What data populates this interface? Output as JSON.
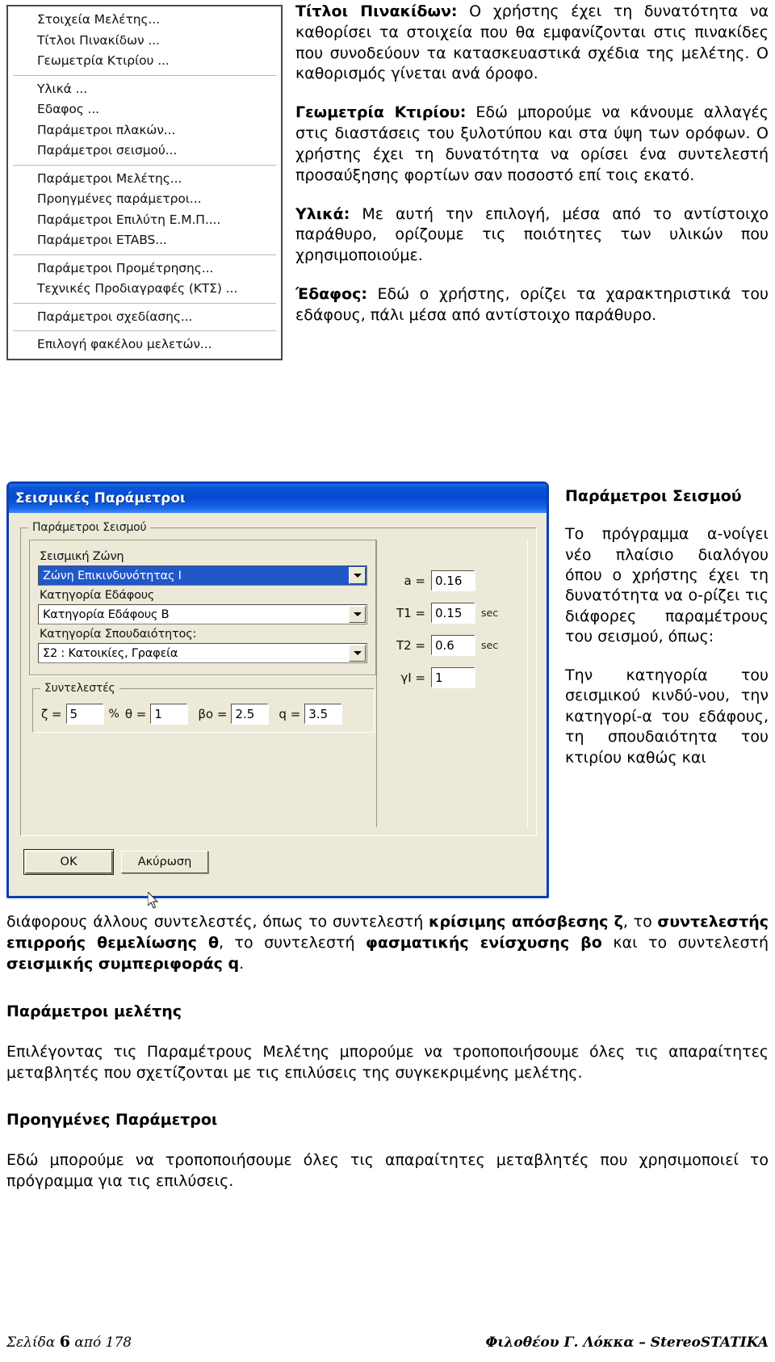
{
  "menu": {
    "groups": [
      {
        "items": [
          "Στοιχεία Μελέτης...",
          "Τίτλοι Πινακίδων ...",
          "Γεωμετρία Κτιρίου ..."
        ]
      },
      {
        "items": [
          "Υλικά ...",
          "Εδαφος ...",
          "Παράμετροι πλακών...",
          "Παράμετροι σεισμού..."
        ]
      },
      {
        "items": [
          "Παράμετροι Μελέτης...",
          "Προηγμένες παράμετροι...",
          "Παράμετροι Επιλύτη Ε.Μ.Π....",
          "Παράμετροι ETABS..."
        ]
      },
      {
        "items": [
          "Παράμετροι Προμέτρησης...",
          "Τεχνικές Προδιαγραφές (ΚΤΣ) ..."
        ]
      },
      {
        "items": [
          "Παράμετροι σχεδίασης..."
        ]
      },
      {
        "items": [
          "Επιλογή φακέλου μελετών..."
        ]
      }
    ]
  },
  "top_text": {
    "p1_lead": "Τίτλοι Πινακίδων:",
    "p1_body": " Ο χρήστης έχει τη δυνατότητα να καθορίσει τα στοιχεία που θα εμφανίζονται στις πινακίδες που συνοδεύουν τα κατασκευαστικά σχέδια της μελέτης. Ο καθορισμός γίνεται ανά όροφο.",
    "p2_lead": "Γεωμετρία Κτιρίου:",
    "p2_body": " Εδώ μπορούμε να κάνουμε αλλαγές στις διαστάσεις του ξυλοτύπου και στα ύψη των ορόφων. Ο χρήστης έχει τη δυνατότητα να ορίσει ένα συντελεστή προσαύξησης φορτίων σαν ποσοστό επί τοις εκατό.",
    "p3_lead": "Υλικά:",
    "p3_body": " Με αυτή την επιλογή, μέσα από το αντίστοιχο παράθυρο, ορίζουμε τις ποιότητες των υλικών που χρησιμοποιούμε.",
    "p4_lead": "Έδαφος:",
    "p4_body": " Εδώ ο χρήστης, ορίζει τα χαρακτηριστικά του εδάφους, πάλι μέσα από αντίστοιχο παράθυρο."
  },
  "dialog": {
    "title": "Σεισμικές Παράμετροι",
    "group_legend": "Παράμετροι Σεισμού",
    "fields": {
      "zone_label": "Σεισμική Ζώνη",
      "zone_value": "Ζώνη Επικινδυνότητας Ι",
      "soil_label": "Κατηγορία Εδάφους",
      "soil_value": "Κατηγορία Εδάφους Β",
      "importance_label": "Κατηγορία Σπουδαιότητος:",
      "importance_value": "Σ2 : Κατοικίες, Γραφεία"
    },
    "coefficients": {
      "legend": "Συντελεστές",
      "zeta_label": "ζ =",
      "zeta_value": "5",
      "zeta_unit": "%",
      "theta_label": "θ =",
      "theta_value": "1",
      "bo_label": "βo =",
      "bo_value": "2.5",
      "q_label": "q =",
      "q_value": "3.5"
    },
    "params": [
      {
        "label": "a =",
        "value": "0.16",
        "unit": ""
      },
      {
        "label": "T1 =",
        "value": "0.15",
        "unit": "sec"
      },
      {
        "label": "T2 =",
        "value": "0.6",
        "unit": "sec"
      },
      {
        "label": "γI =",
        "value": "1",
        "unit": ""
      }
    ],
    "buttons": {
      "ok": "OK",
      "cancel": "Ακύρωση"
    }
  },
  "side_text": {
    "heading": "Παράμετροι Σεισμού",
    "p1": "Το πρόγραμμα α-νοίγει νέο πλαίσιο διαλόγου όπου ο χρήστης έχει τη δυνατότητα να ο-ρίζει τις διάφορες παραμέτρους του σεισμού, όπως:",
    "p2": "Την κατηγορία του σεισμικού κινδύ-νου, την κατηγορί-α του εδάφους, τη σπουδαιότητα του κτιρίου καθώς και"
  },
  "lower_text": {
    "p1_a": "διάφορους άλλους συντελεστές, όπως το συντελεστή ",
    "p1_b1": "κρίσιμης απόσβεσης ζ",
    "p1_c": ", το ",
    "p1_b2": "συντελεστής επιρροής θεμελίωσης θ",
    "p1_d": ", το συντελεστή ",
    "p1_b3": "φασματικής ενίσχυσης βo",
    "p1_e": " και το συντελεστή ",
    "p1_b4": "σεισμικής συμπεριφοράς q",
    "p1_f": ".",
    "h1": "Παράμετροι μελέτης",
    "p2": "Επιλέγοντας τις Παραμέτρους Μελέτης μπορούμε να τροποποιήσουμε όλες τις απαραίτητες μεταβλητές που σχετίζονται με τις επιλύσεις της συγκεκριμένης μελέτης.",
    "h2": "Προηγμένες Παράμετροι",
    "p3": "Εδώ μπορούμε να τροποποιήσουμε όλες τις απαραίτητες μεταβλητές που χρησιμοποιεί το πρόγραμμα για τις επιλύσεις."
  },
  "footer": {
    "left_pre": "Σελίδα ",
    "page_number": "6",
    "left_post": " από 178",
    "right": "Φιλοθέου Γ. Λόκκα – StereoSTATIKA"
  }
}
